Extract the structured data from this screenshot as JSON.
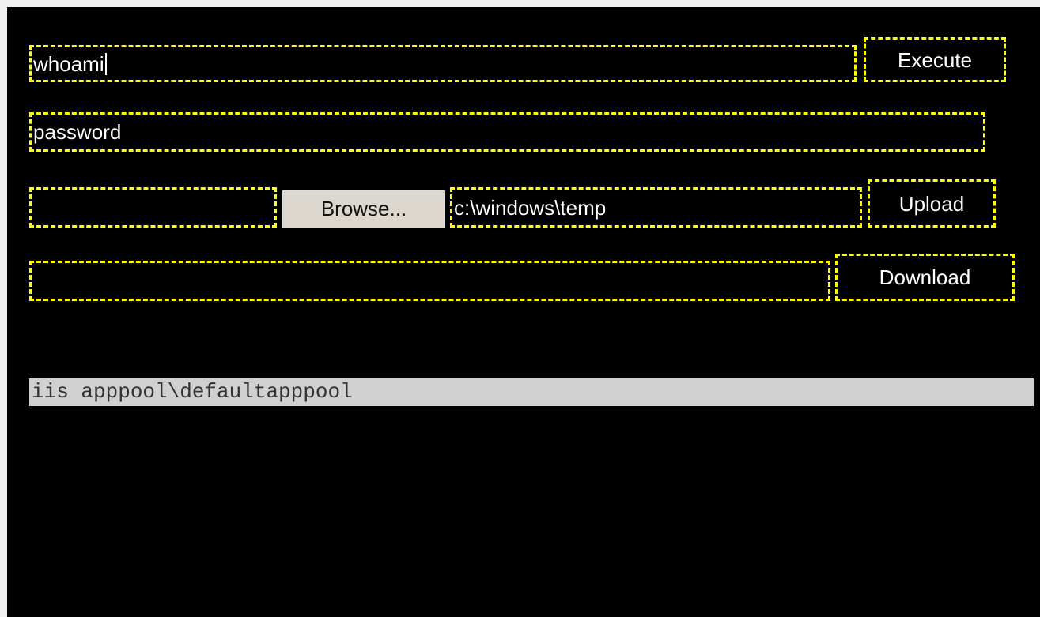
{
  "command": {
    "value": "whoami",
    "execute_label": "Execute"
  },
  "password": {
    "value": "password"
  },
  "upload": {
    "file_value": "",
    "browse_label": "Browse...",
    "path_value": "c:\\windows\\temp",
    "upload_label": "Upload"
  },
  "download": {
    "path_value": "",
    "download_label": "Download"
  },
  "output": {
    "text": "iis apppool\\defaultapppool"
  },
  "colors": {
    "background": "#000000",
    "border": "#ffff00",
    "text": "#ffffff",
    "output_background": "#d0d0d0",
    "browse_background": "#dcd8d0"
  }
}
